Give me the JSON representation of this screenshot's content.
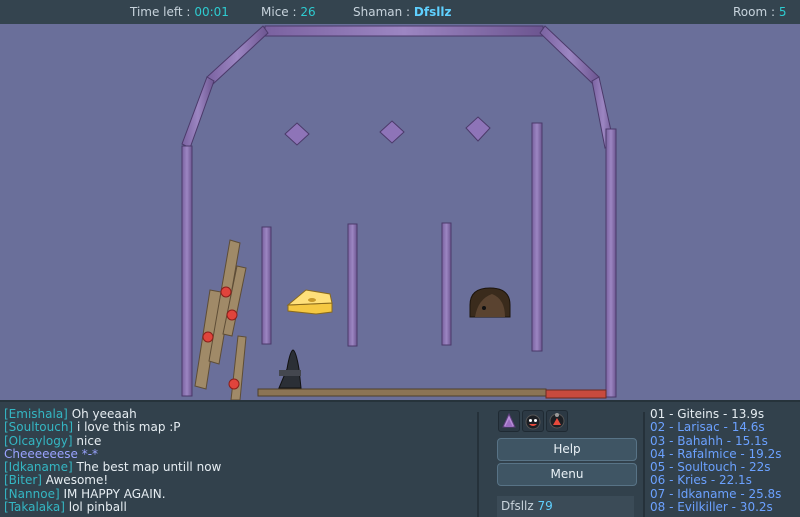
{
  "topbar": {
    "time_label": "Time left :",
    "time_value": "00:01",
    "mice_label": "Mice :",
    "mice_value": "26",
    "shaman_label": "Shaman :",
    "shaman_value": "Dfsllz",
    "room_label": "Room :",
    "room_value": "5"
  },
  "chat": [
    {
      "name": "[Emishala]",
      "text": " Oh yeeaah"
    },
    {
      "name": "[Soultouch]",
      "text": " i love this map :P"
    },
    {
      "name": "[Olcaylogy]",
      "text": " nice"
    },
    {
      "name": "",
      "text": "Cheeeeeese *-*"
    },
    {
      "name": "[Idkaname]",
      "text": " The best map untill now"
    },
    {
      "name": "[Biter]",
      "text": " Awesome!"
    },
    {
      "name": "[Nannoe]",
      "text": " IM HAPPY AGAIN."
    },
    {
      "name": "[Takalaka]",
      "text": " lol pinball"
    }
  ],
  "buttons": {
    "help": "Help",
    "menu": "Menu"
  },
  "icons": [
    "shaman-icon",
    "mouse-face-icon",
    "emote-icon"
  ],
  "shaman_panel": {
    "name": "Dfsllz",
    "score": "79"
  },
  "ranking": [
    "01 - Giteins - 13.9s",
    "02 - Larisac - 14.6s",
    "03 - Bahahh - 15.1s",
    "04 - Rafalmice - 19.2s",
    "05 - Soultouch - 22s",
    "06 - Kries - 22.1s",
    "07 - Idkaname - 25.8s",
    "08 - Evilkiller - 30.2s"
  ],
  "colors": {
    "stage": "#6a6f9a",
    "wall": "#8a72b0",
    "accent": "#2ecbd0"
  }
}
